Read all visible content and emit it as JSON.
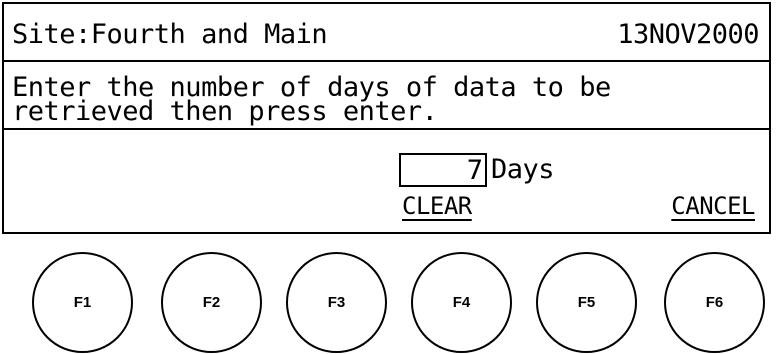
{
  "header": {
    "site": "Site:Fourth and Main",
    "date": "13NOV2000"
  },
  "prompt": {
    "text": "Enter the number of days of data to be\nretrieved then press enter."
  },
  "entry": {
    "value": "7",
    "unit": "Days"
  },
  "softkeys": {
    "clear_label": "CLEAR",
    "cancel_label": "CANCEL"
  },
  "function_keys": [
    "F1",
    "F2",
    "F3",
    "F4",
    "F5",
    "F6"
  ],
  "colors": {
    "foreground": "#000000",
    "background": "#ffffff"
  }
}
